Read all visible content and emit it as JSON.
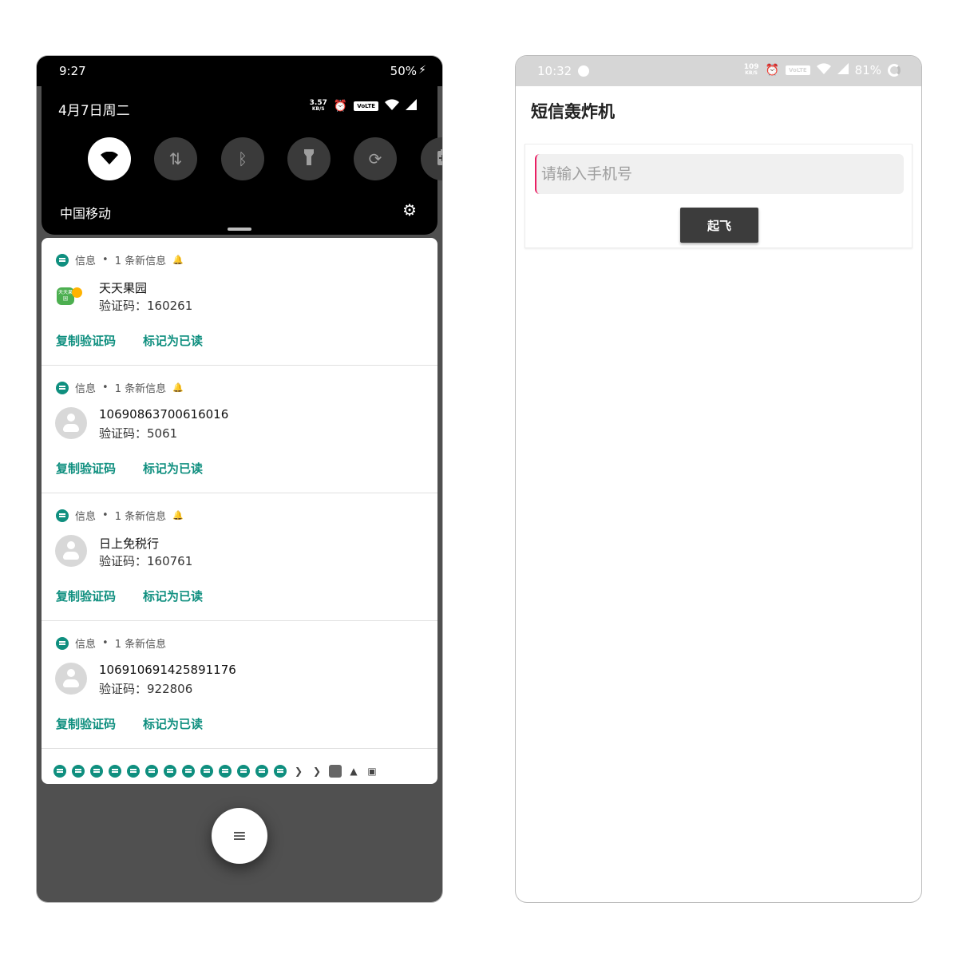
{
  "left_phone": {
    "statusbar": {
      "time": "9:27",
      "battery": "50%",
      "charging_icon": "bolt-icon"
    },
    "quick_settings": {
      "date": "4月7日周二",
      "netspeed_value": "3.57",
      "netspeed_unit": "KB/S",
      "volte": "VoLTE",
      "tiles": [
        "wifi-icon",
        "mobile-data-icon",
        "bluetooth-icon",
        "flashlight-icon",
        "auto-rotate-icon",
        "battery-saver-icon"
      ],
      "carrier": "中国移动"
    },
    "notifications": [
      {
        "app": "信息",
        "summary": "1 条新信息",
        "title": "天天果园",
        "logo_text": "天天果园",
        "body": "验证码：160261",
        "actions": [
          "复制验证码",
          "标记为已读"
        ]
      },
      {
        "app": "信息",
        "summary": "1 条新信息",
        "title": "10690863700616016",
        "body": "验证码：5061",
        "actions": [
          "复制验证码",
          "标记为已读"
        ]
      },
      {
        "app": "信息",
        "summary": "1 条新信息",
        "title": "日上免税行",
        "body": "验证码：160761",
        "actions": [
          "复制验证码",
          "标记为已读"
        ]
      },
      {
        "app": "信息",
        "summary": "1 条新信息",
        "title": "106910691425891176",
        "body": "验证码：922806",
        "actions": [
          "复制验证码",
          "标记为已读"
        ]
      }
    ],
    "accent_color": "#0f8f7f"
  },
  "right_phone": {
    "statusbar": {
      "time": "10:32",
      "netspeed_value": "109",
      "netspeed_unit": "KB/S",
      "volte": "VoLTE",
      "battery": "81%"
    },
    "app_title": "短信轰炸机",
    "phone_input": {
      "placeholder": "请输入手机号",
      "value": ""
    },
    "takeoff_button": "起飞"
  }
}
